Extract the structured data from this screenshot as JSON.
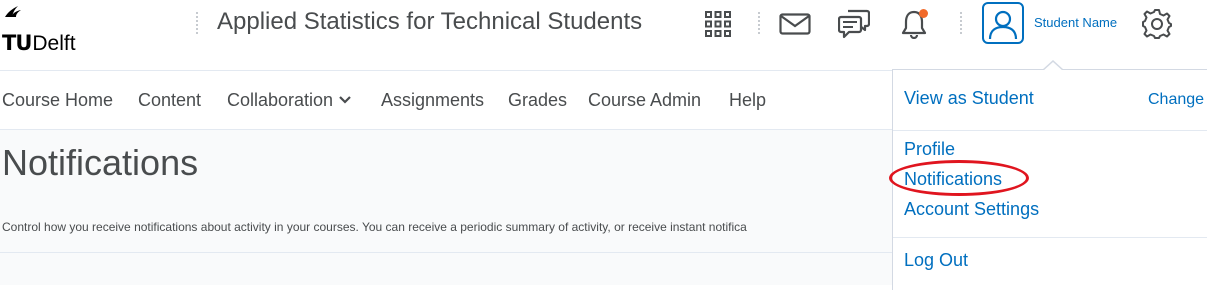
{
  "header": {
    "logo_tu": "TU",
    "logo_delft": "Delft",
    "course_title": "Applied Statistics for Technical Students",
    "user_name": "Student Name",
    "icons": [
      "waffle-icon",
      "mail-icon",
      "chat-icon",
      "bell-icon",
      "user-avatar-icon",
      "gear-icon"
    ],
    "notification_dot_color": "#f16a2a"
  },
  "nav": {
    "items": [
      {
        "label": "Course Home"
      },
      {
        "label": "Content"
      },
      {
        "label": "Collaboration"
      },
      {
        "label": "Assignments"
      },
      {
        "label": "Grades"
      },
      {
        "label": "Course Admin"
      },
      {
        "label": "Help"
      }
    ]
  },
  "main": {
    "title": "Notifications",
    "description": "Control how you receive notifications about activity in your courses. You can receive a periodic summary of activity, or receive instant notifica"
  },
  "user_menu": {
    "view_as": "View as Student",
    "change": "Change",
    "profile": "Profile",
    "notifications": "Notifications",
    "account_settings": "Account Settings",
    "logout": "Log Out"
  },
  "colors": {
    "link": "#006fbf",
    "text": "#494c4e",
    "highlight": "#e0151f"
  }
}
